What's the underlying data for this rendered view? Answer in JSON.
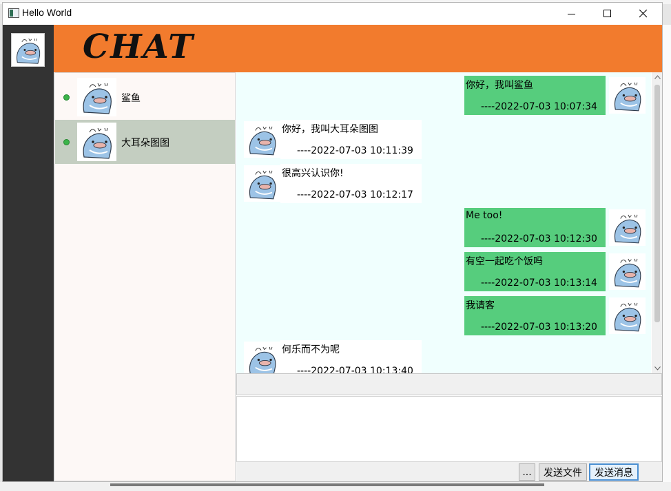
{
  "window": {
    "title": "Hello World"
  },
  "header": {
    "logo_text": "CHAT"
  },
  "contacts": [
    {
      "name": "鲨鱼",
      "online": true,
      "selected": false
    },
    {
      "name": "大耳朵图图",
      "online": true,
      "selected": true
    }
  ],
  "messages": [
    {
      "side": "right",
      "text": "你好，我叫鲨鱼",
      "time": "----2022-07-03 10:07:34"
    },
    {
      "side": "left",
      "text": "你好，我叫大耳朵图图",
      "time": "----2022-07-03 10:11:39"
    },
    {
      "side": "left",
      "text": "很高兴认识你!",
      "time": "----2022-07-03 10:12:17"
    },
    {
      "side": "right",
      "text": "Me too!",
      "time": "----2022-07-03 10:12:30"
    },
    {
      "side": "right",
      "text": "有空一起吃个饭吗",
      "time": "----2022-07-03 10:13:14"
    },
    {
      "side": "right",
      "text": "我请客",
      "time": "----2022-07-03 10:13:20"
    },
    {
      "side": "left",
      "text": "何乐而不为呢",
      "time": "----2022-07-03 10:13:40"
    }
  ],
  "composer": {
    "more_label": "...",
    "send_file_label": "发送文件",
    "send_message_label": "发送消息"
  },
  "colors": {
    "header": "#f27b2d",
    "sidebar": "#333333",
    "own_bubble": "#56cd7d",
    "online_dot": "#3bb44a",
    "selected_contact": "#c4cec1"
  }
}
